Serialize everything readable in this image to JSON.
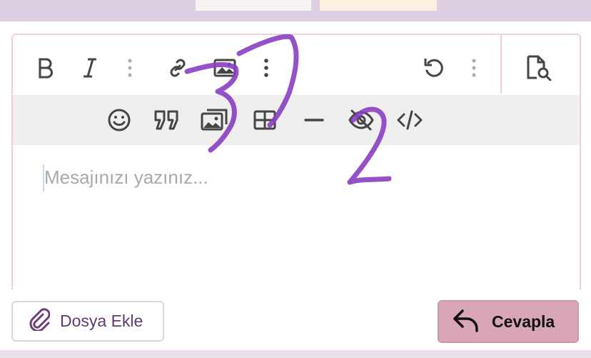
{
  "editor": {
    "toolbar_primary": [
      {
        "name": "bold-icon"
      },
      {
        "name": "italic-icon"
      },
      {
        "name": "more-text-options-icon"
      },
      {
        "name": "link-icon"
      },
      {
        "name": "image-icon"
      },
      {
        "name": "more-insert-options-icon"
      },
      {
        "name": "undo-icon"
      },
      {
        "name": "more-options-icon"
      },
      {
        "name": "preview-icon"
      }
    ],
    "toolbar_secondary": [
      {
        "name": "emoji-icon"
      },
      {
        "name": "quote-icon"
      },
      {
        "name": "media-gallery-icon"
      },
      {
        "name": "table-icon"
      },
      {
        "name": "horizontal-rule-icon"
      },
      {
        "name": "spoiler-icon"
      },
      {
        "name": "code-icon"
      }
    ],
    "placeholder": "Mesajınızı yazınız..."
  },
  "actions": {
    "attach_label": "Dosya Ekle",
    "reply_label": "Cevapla"
  },
  "annotations": {
    "mark_a": "3",
    "mark_b": "2",
    "color": "#8a3fc1"
  }
}
